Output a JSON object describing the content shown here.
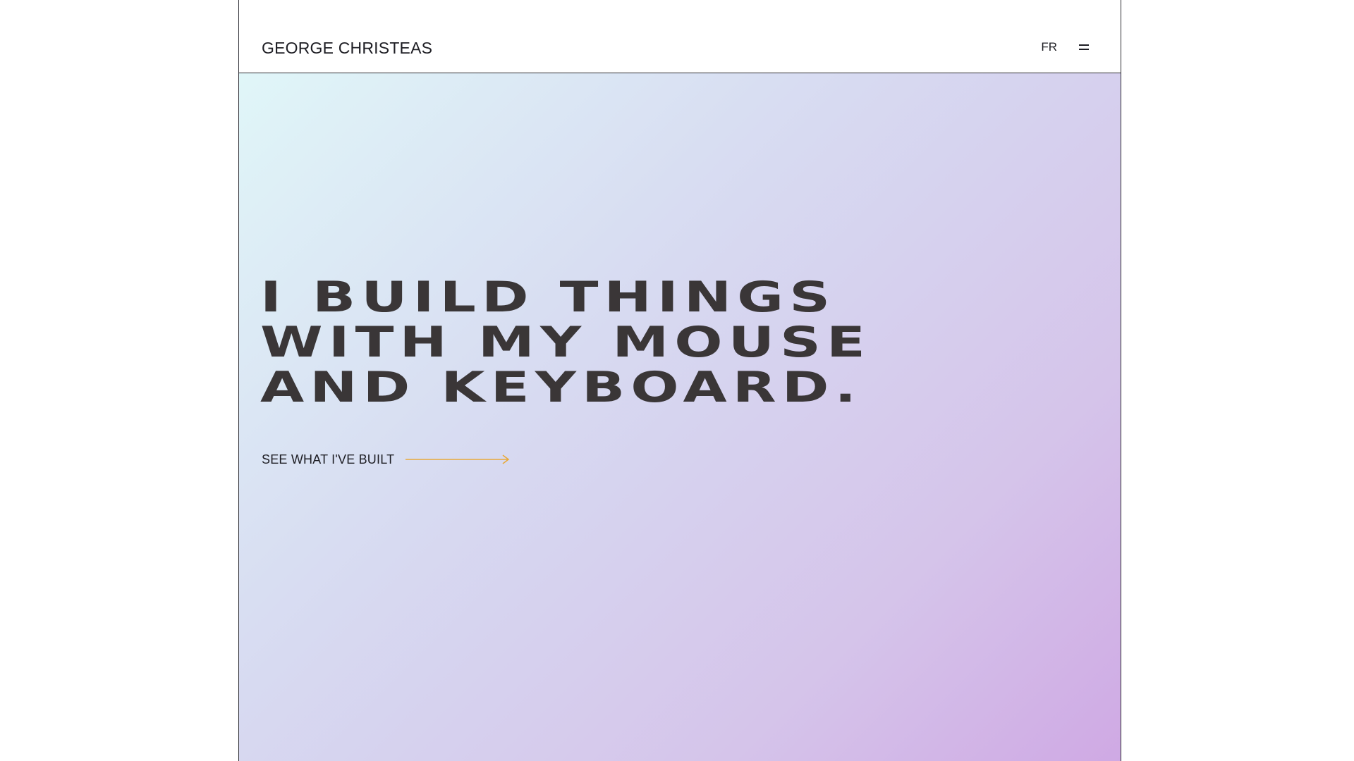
{
  "header": {
    "brand": "GEORGE CHRISTEAS",
    "language_toggle": "FR",
    "menu_icon": "hamburger-menu-icon"
  },
  "hero": {
    "headline_lines": [
      "I BUILD THINGS",
      "WITH MY MOUSE",
      "AND KEYBOARD."
    ],
    "cta_label": "SEE WHAT I'VE BUILT",
    "cta_icon": "arrow-right-icon"
  },
  "colors": {
    "text": "#2a2a2e",
    "headline": "#3a3637",
    "arrow_accent": "#e8a93a",
    "gradient_start": "#e0f6f8",
    "gradient_mid": "#d7daf1",
    "gradient_end": "#cfa9e4",
    "border": "#2d2d33"
  }
}
